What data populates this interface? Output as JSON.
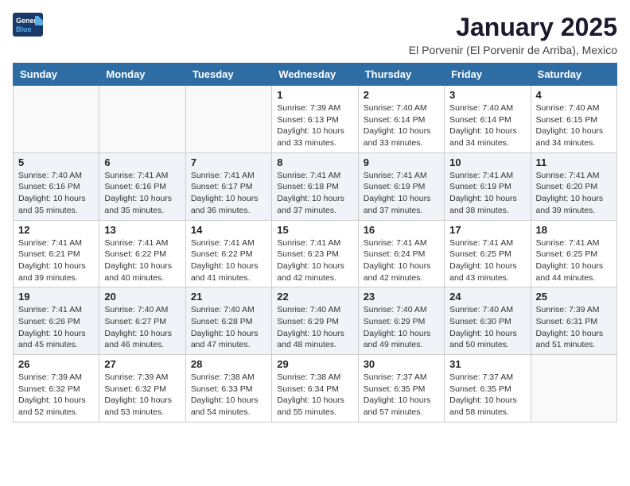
{
  "header": {
    "logo_general": "General",
    "logo_blue": "Blue",
    "month_title": "January 2025",
    "location": "El Porvenir (El Porvenir de Arriba), Mexico"
  },
  "weekdays": [
    "Sunday",
    "Monday",
    "Tuesday",
    "Wednesday",
    "Thursday",
    "Friday",
    "Saturday"
  ],
  "weeks": [
    [
      {
        "day": "",
        "info": ""
      },
      {
        "day": "",
        "info": ""
      },
      {
        "day": "",
        "info": ""
      },
      {
        "day": "1",
        "info": "Sunrise: 7:39 AM\nSunset: 6:13 PM\nDaylight: 10 hours\nand 33 minutes."
      },
      {
        "day": "2",
        "info": "Sunrise: 7:40 AM\nSunset: 6:14 PM\nDaylight: 10 hours\nand 33 minutes."
      },
      {
        "day": "3",
        "info": "Sunrise: 7:40 AM\nSunset: 6:14 PM\nDaylight: 10 hours\nand 34 minutes."
      },
      {
        "day": "4",
        "info": "Sunrise: 7:40 AM\nSunset: 6:15 PM\nDaylight: 10 hours\nand 34 minutes."
      }
    ],
    [
      {
        "day": "5",
        "info": "Sunrise: 7:40 AM\nSunset: 6:16 PM\nDaylight: 10 hours\nand 35 minutes."
      },
      {
        "day": "6",
        "info": "Sunrise: 7:41 AM\nSunset: 6:16 PM\nDaylight: 10 hours\nand 35 minutes."
      },
      {
        "day": "7",
        "info": "Sunrise: 7:41 AM\nSunset: 6:17 PM\nDaylight: 10 hours\nand 36 minutes."
      },
      {
        "day": "8",
        "info": "Sunrise: 7:41 AM\nSunset: 6:18 PM\nDaylight: 10 hours\nand 37 minutes."
      },
      {
        "day": "9",
        "info": "Sunrise: 7:41 AM\nSunset: 6:19 PM\nDaylight: 10 hours\nand 37 minutes."
      },
      {
        "day": "10",
        "info": "Sunrise: 7:41 AM\nSunset: 6:19 PM\nDaylight: 10 hours\nand 38 minutes."
      },
      {
        "day": "11",
        "info": "Sunrise: 7:41 AM\nSunset: 6:20 PM\nDaylight: 10 hours\nand 39 minutes."
      }
    ],
    [
      {
        "day": "12",
        "info": "Sunrise: 7:41 AM\nSunset: 6:21 PM\nDaylight: 10 hours\nand 39 minutes."
      },
      {
        "day": "13",
        "info": "Sunrise: 7:41 AM\nSunset: 6:22 PM\nDaylight: 10 hours\nand 40 minutes."
      },
      {
        "day": "14",
        "info": "Sunrise: 7:41 AM\nSunset: 6:22 PM\nDaylight: 10 hours\nand 41 minutes."
      },
      {
        "day": "15",
        "info": "Sunrise: 7:41 AM\nSunset: 6:23 PM\nDaylight: 10 hours\nand 42 minutes."
      },
      {
        "day": "16",
        "info": "Sunrise: 7:41 AM\nSunset: 6:24 PM\nDaylight: 10 hours\nand 42 minutes."
      },
      {
        "day": "17",
        "info": "Sunrise: 7:41 AM\nSunset: 6:25 PM\nDaylight: 10 hours\nand 43 minutes."
      },
      {
        "day": "18",
        "info": "Sunrise: 7:41 AM\nSunset: 6:25 PM\nDaylight: 10 hours\nand 44 minutes."
      }
    ],
    [
      {
        "day": "19",
        "info": "Sunrise: 7:41 AM\nSunset: 6:26 PM\nDaylight: 10 hours\nand 45 minutes."
      },
      {
        "day": "20",
        "info": "Sunrise: 7:40 AM\nSunset: 6:27 PM\nDaylight: 10 hours\nand 46 minutes."
      },
      {
        "day": "21",
        "info": "Sunrise: 7:40 AM\nSunset: 6:28 PM\nDaylight: 10 hours\nand 47 minutes."
      },
      {
        "day": "22",
        "info": "Sunrise: 7:40 AM\nSunset: 6:29 PM\nDaylight: 10 hours\nand 48 minutes."
      },
      {
        "day": "23",
        "info": "Sunrise: 7:40 AM\nSunset: 6:29 PM\nDaylight: 10 hours\nand 49 minutes."
      },
      {
        "day": "24",
        "info": "Sunrise: 7:40 AM\nSunset: 6:30 PM\nDaylight: 10 hours\nand 50 minutes."
      },
      {
        "day": "25",
        "info": "Sunrise: 7:39 AM\nSunset: 6:31 PM\nDaylight: 10 hours\nand 51 minutes."
      }
    ],
    [
      {
        "day": "26",
        "info": "Sunrise: 7:39 AM\nSunset: 6:32 PM\nDaylight: 10 hours\nand 52 minutes."
      },
      {
        "day": "27",
        "info": "Sunrise: 7:39 AM\nSunset: 6:32 PM\nDaylight: 10 hours\nand 53 minutes."
      },
      {
        "day": "28",
        "info": "Sunrise: 7:38 AM\nSunset: 6:33 PM\nDaylight: 10 hours\nand 54 minutes."
      },
      {
        "day": "29",
        "info": "Sunrise: 7:38 AM\nSunset: 6:34 PM\nDaylight: 10 hours\nand 55 minutes."
      },
      {
        "day": "30",
        "info": "Sunrise: 7:37 AM\nSunset: 6:35 PM\nDaylight: 10 hours\nand 57 minutes."
      },
      {
        "day": "31",
        "info": "Sunrise: 7:37 AM\nSunset: 6:35 PM\nDaylight: 10 hours\nand 58 minutes."
      },
      {
        "day": "",
        "info": ""
      }
    ]
  ]
}
